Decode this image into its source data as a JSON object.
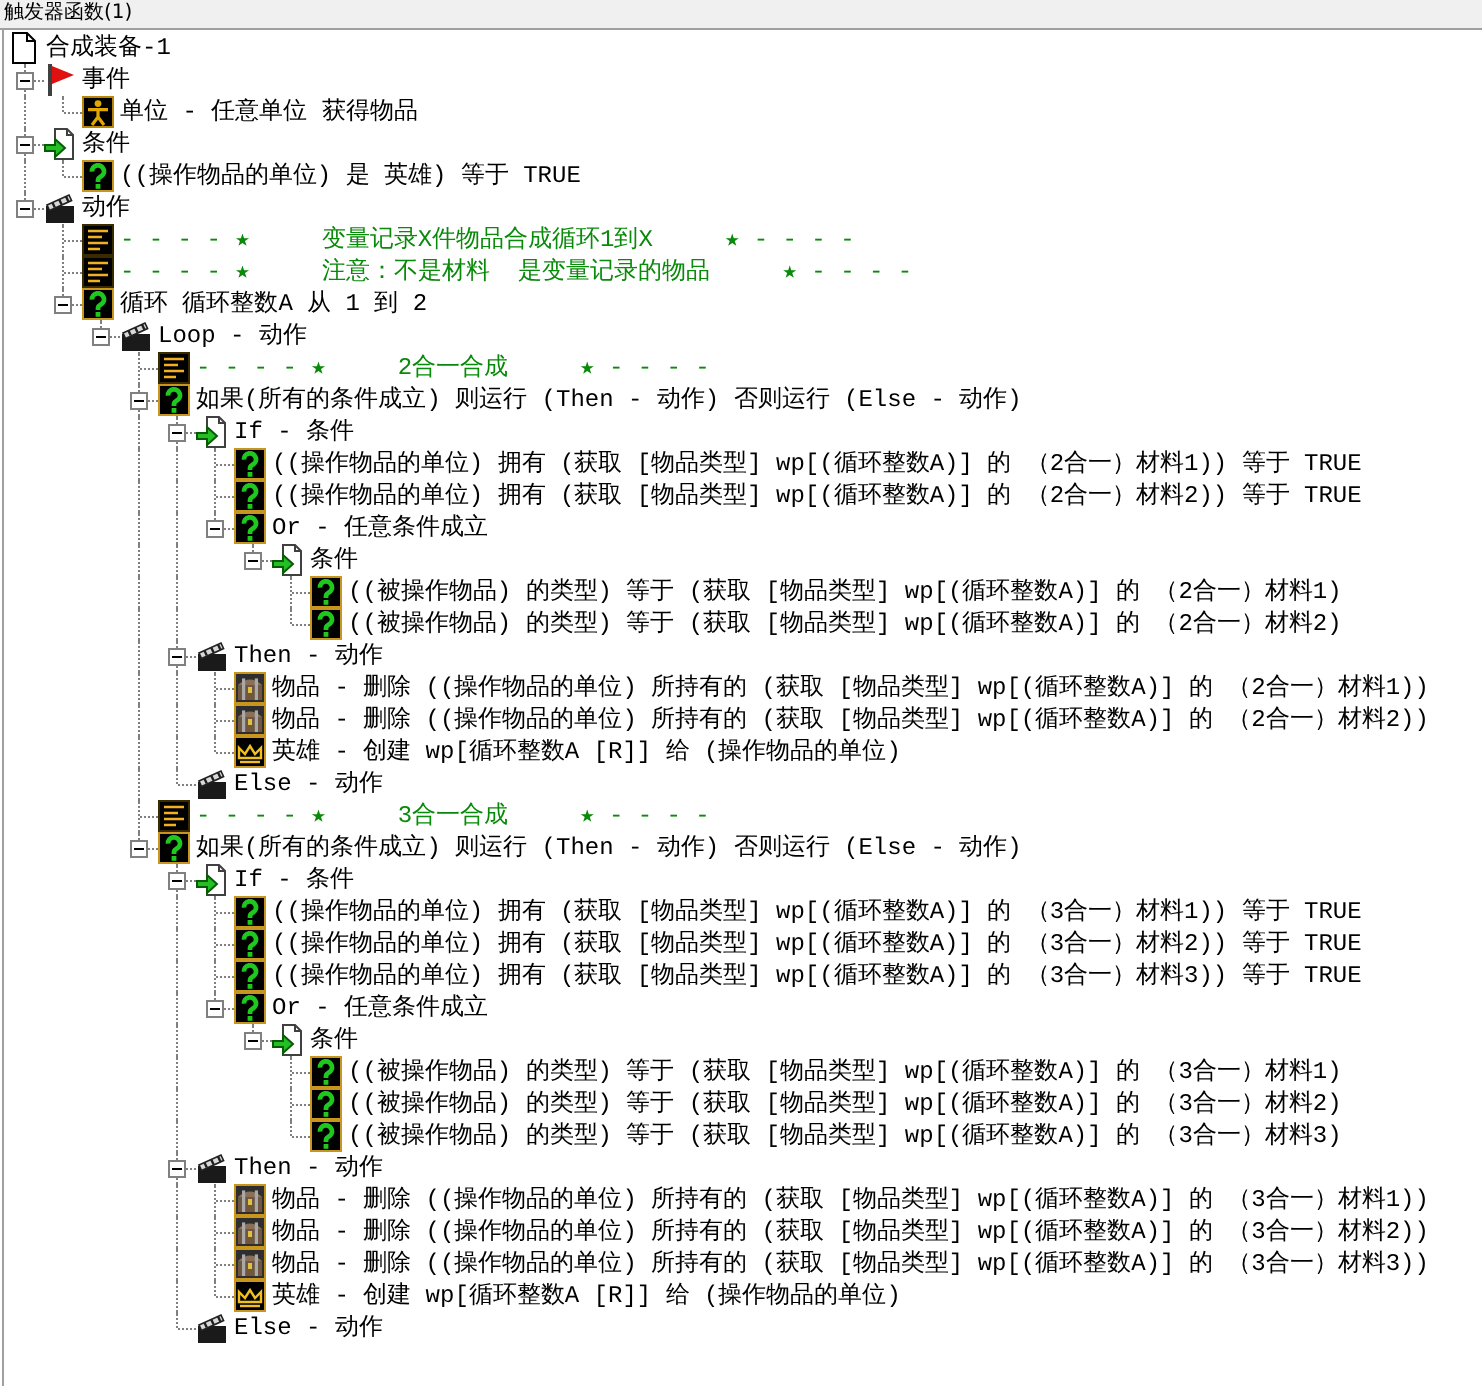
{
  "header": {
    "title": "触发器函数(1)"
  },
  "tree": {
    "kind": "trigger",
    "label": "合成装备-1",
    "children": [
      {
        "kind": "events",
        "label": "事件",
        "expanded": true,
        "children": [
          {
            "kind": "event",
            "label": "单位 - 任意单位 获得物品"
          }
        ]
      },
      {
        "kind": "conditions",
        "label": "条件",
        "expanded": true,
        "children": [
          {
            "kind": "condition",
            "label": "((操作物品的单位) 是 英雄) 等于 TRUE"
          }
        ]
      },
      {
        "kind": "actions",
        "label": "动作",
        "expanded": true,
        "children": [
          {
            "kind": "comment",
            "label": "- - - - ★     变量记录X件物品合成循环1到X     ★ - - - -"
          },
          {
            "kind": "comment",
            "label": "- - - - ★     注意：不是材料  是变量记录的物品     ★ - - - -"
          },
          {
            "kind": "function",
            "label": "循环 循环整数A 从 1 到 2",
            "expanded": true,
            "children": [
              {
                "kind": "actions",
                "label": "Loop - 动作",
                "expanded": true,
                "children": [
                  {
                    "kind": "comment",
                    "label": "- - - - ★     2合一合成     ★ - - - -"
                  },
                  {
                    "kind": "function",
                    "label": "如果(所有的条件成立) 则运行 (Then - 动作) 否则运行 (Else - 动作)",
                    "expanded": true,
                    "children": [
                      {
                        "kind": "conditions",
                        "label": "If - 条件",
                        "expanded": true,
                        "children": [
                          {
                            "kind": "condition",
                            "label": "((操作物品的单位) 拥有 (获取 [物品类型] wp[(循环整数A)] 的 （2合一）材料1)) 等于 TRUE"
                          },
                          {
                            "kind": "condition",
                            "label": "((操作物品的单位) 拥有 (获取 [物品类型] wp[(循环整数A)] 的 （2合一）材料2)) 等于 TRUE"
                          },
                          {
                            "kind": "function",
                            "label": "Or - 任意条件成立",
                            "expanded": true,
                            "children": [
                              {
                                "kind": "conditions",
                                "label": "条件",
                                "expanded": true,
                                "children": [
                                  {
                                    "kind": "condition",
                                    "label": "((被操作物品) 的类型) 等于 (获取 [物品类型] wp[(循环整数A)] 的 （2合一）材料1)"
                                  },
                                  {
                                    "kind": "condition",
                                    "label": "((被操作物品) 的类型) 等于 (获取 [物品类型] wp[(循环整数A)] 的 （2合一）材料2)"
                                  }
                                ]
                              }
                            ]
                          }
                        ]
                      },
                      {
                        "kind": "actions",
                        "label": "Then - 动作",
                        "expanded": true,
                        "children": [
                          {
                            "kind": "item-action",
                            "label": "物品 - 删除 ((操作物品的单位) 所持有的 (获取 [物品类型] wp[(循环整数A)] 的 （2合一）材料1))"
                          },
                          {
                            "kind": "item-action",
                            "label": "物品 - 删除 ((操作物品的单位) 所持有的 (获取 [物品类型] wp[(循环整数A)] 的 （2合一）材料2))"
                          },
                          {
                            "kind": "hero-action",
                            "label": "英雄 - 创建 wp[循环整数A [R]] 给 (操作物品的单位)"
                          }
                        ]
                      },
                      {
                        "kind": "actions",
                        "label": "Else - 动作"
                      }
                    ]
                  },
                  {
                    "kind": "comment",
                    "label": "- - - - ★     3合一合成     ★ - - - -"
                  },
                  {
                    "kind": "function",
                    "label": "如果(所有的条件成立) 则运行 (Then - 动作) 否则运行 (Else - 动作)",
                    "expanded": true,
                    "children": [
                      {
                        "kind": "conditions",
                        "label": "If - 条件",
                        "expanded": true,
                        "children": [
                          {
                            "kind": "condition",
                            "label": "((操作物品的单位) 拥有 (获取 [物品类型] wp[(循环整数A)] 的 （3合一）材料1)) 等于 TRUE"
                          },
                          {
                            "kind": "condition",
                            "label": "((操作物品的单位) 拥有 (获取 [物品类型] wp[(循环整数A)] 的 （3合一）材料2)) 等于 TRUE"
                          },
                          {
                            "kind": "condition",
                            "label": "((操作物品的单位) 拥有 (获取 [物品类型] wp[(循环整数A)] 的 （3合一）材料3)) 等于 TRUE"
                          },
                          {
                            "kind": "function",
                            "label": "Or - 任意条件成立",
                            "expanded": true,
                            "children": [
                              {
                                "kind": "conditions",
                                "label": "条件",
                                "expanded": true,
                                "children": [
                                  {
                                    "kind": "condition",
                                    "label": "((被操作物品) 的类型) 等于 (获取 [物品类型] wp[(循环整数A)] 的 （3合一）材料1)"
                                  },
                                  {
                                    "kind": "condition",
                                    "label": "((被操作物品) 的类型) 等于 (获取 [物品类型] wp[(循环整数A)] 的 （3合一）材料2)"
                                  },
                                  {
                                    "kind": "condition",
                                    "label": "((被操作物品) 的类型) 等于 (获取 [物品类型] wp[(循环整数A)] 的 （3合一）材料3)"
                                  }
                                ]
                              }
                            ]
                          }
                        ]
                      },
                      {
                        "kind": "actions",
                        "label": "Then - 动作",
                        "expanded": true,
                        "children": [
                          {
                            "kind": "item-action",
                            "label": "物品 - 删除 ((操作物品的单位) 所持有的 (获取 [物品类型] wp[(循环整数A)] 的 （3合一）材料1))"
                          },
                          {
                            "kind": "item-action",
                            "label": "物品 - 删除 ((操作物品的单位) 所持有的 (获取 [物品类型] wp[(循环整数A)] 的 （3合一）材料2))"
                          },
                          {
                            "kind": "item-action",
                            "label": "物品 - 删除 ((操作物品的单位) 所持有的 (获取 [物品类型] wp[(循环整数A)] 的 （3合一）材料3))"
                          },
                          {
                            "kind": "hero-action",
                            "label": "英雄 - 创建 wp[循环整数A [R]] 给 (操作物品的单位)"
                          }
                        ]
                      },
                      {
                        "kind": "actions",
                        "label": "Else - 动作"
                      }
                    ]
                  }
                ]
              }
            ]
          }
        ]
      }
    ]
  }
}
